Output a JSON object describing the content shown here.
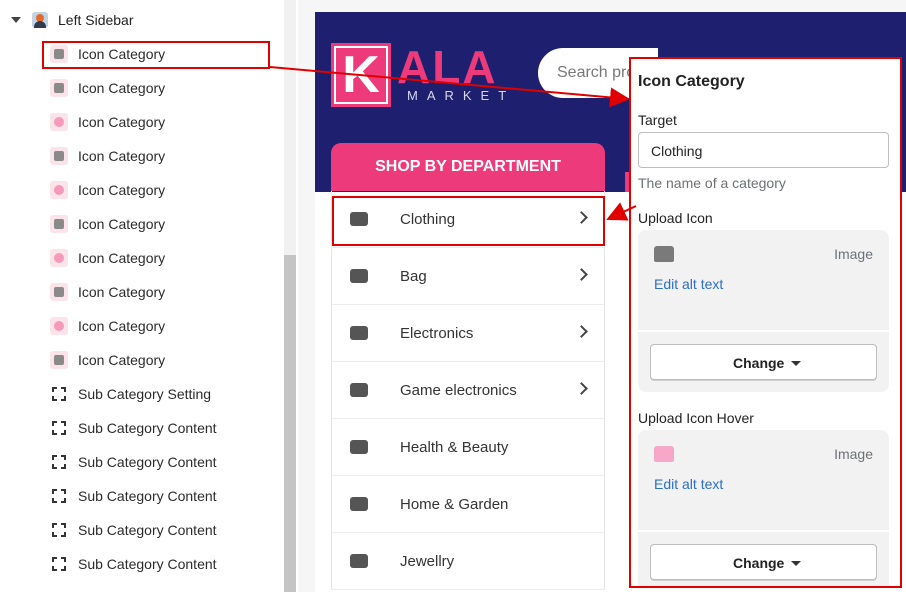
{
  "tree": {
    "section_title": "Left Sidebar",
    "items": [
      {
        "label": "Icon Category",
        "icon": "tshirt-icon"
      },
      {
        "label": "Icon Category",
        "icon": "bag-icon"
      },
      {
        "label": "Icon Category",
        "icon": "camera-icon"
      },
      {
        "label": "Icon Category",
        "icon": "gamepad-icon"
      },
      {
        "label": "Icon Category",
        "icon": "cosmetics-icon"
      },
      {
        "label": "Icon Category",
        "icon": "bathtub-icon"
      },
      {
        "label": "Icon Category",
        "icon": "diamond-icon"
      },
      {
        "label": "Icon Category",
        "icon": "rattle-icon"
      },
      {
        "label": "Icon Category",
        "icon": "toy-icon"
      },
      {
        "label": "Icon Category",
        "icon": "boot-icon"
      },
      {
        "label": "Sub Category Setting",
        "icon": "section-bracket-icon"
      },
      {
        "label": "Sub Category Content",
        "icon": "section-bracket-icon"
      },
      {
        "label": "Sub Category Content",
        "icon": "section-bracket-icon"
      },
      {
        "label": "Sub Category Content",
        "icon": "section-bracket-icon"
      },
      {
        "label": "Sub Category Content",
        "icon": "section-bracket-icon"
      },
      {
        "label": "Sub Category Content",
        "icon": "section-bracket-icon"
      }
    ]
  },
  "site": {
    "logo_letter": "K",
    "logo_ala": "ALA",
    "logo_market": "MARKET",
    "search_placeholder": "Search pro",
    "shop_button": "SHOP BY DEPARTMENT",
    "departments": [
      {
        "label": "Clothing",
        "icon": "tshirt-icon",
        "has_arrow": true
      },
      {
        "label": "Bag",
        "icon": "bag-icon",
        "has_arrow": true
      },
      {
        "label": "Electronics",
        "icon": "camera-icon",
        "has_arrow": true
      },
      {
        "label": "Game electronics",
        "icon": "gamepad-icon",
        "has_arrow": true
      },
      {
        "label": "Health & Beauty",
        "icon": "cosmetics-icon",
        "has_arrow": false
      },
      {
        "label": "Home & Garden",
        "icon": "bathtub-icon",
        "has_arrow": false
      },
      {
        "label": "Jewellry",
        "icon": "diamond-icon",
        "has_arrow": false
      }
    ]
  },
  "settings": {
    "title": "Icon Category",
    "target_label": "Target",
    "target_value": "Clothing",
    "target_help": "The name of a category",
    "upload_icon_label": "Upload Icon",
    "upload_icon_hover_label": "Upload Icon Hover",
    "image_type": "Image",
    "edit_alt": "Edit alt text",
    "change_button": "Change"
  },
  "colors": {
    "brand_pink": "#ec3a7a",
    "header_navy": "#1e1f6e",
    "annotation_red": "#e00000",
    "link_blue": "#2c6ecb"
  }
}
